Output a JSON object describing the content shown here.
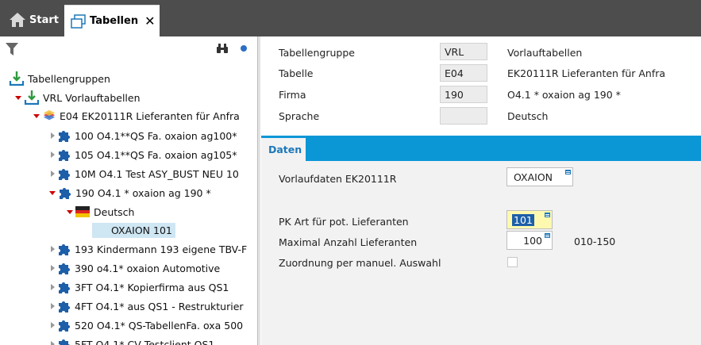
{
  "tabs": {
    "start_label": "Start",
    "tabellen_label": "Tabellen"
  },
  "tree": {
    "nodes": [
      {
        "label": "Tabellengruppen"
      },
      {
        "label": "VRL  Vorlauftabellen"
      },
      {
        "label": "E04  EK20111R Lieferanten für Anfra"
      },
      {
        "label": "100 O4.1**QS Fa. oxaion ag100*"
      },
      {
        "label": "105 O4.1**QS Fa. oxaion ag105*"
      },
      {
        "label": "10M O4.1 Test ASY_BUST NEU   10"
      },
      {
        "label": "190 O4.1 * oxaion ag 190   *"
      },
      {
        "label": "Deutsch"
      },
      {
        "label": "OXAION  101"
      },
      {
        "label": "193 Kindermann 193 eigene TBV-F"
      },
      {
        "label": "390 o4.1* oxaion Automotive"
      },
      {
        "label": "3FT O4.1* Kopierfirma aus  QS1"
      },
      {
        "label": "4FT O4.1* aus QS1 - Restrukturier"
      },
      {
        "label": "520 O4.1* QS-TabellenFa. oxa 500"
      },
      {
        "label": "5FT O4.1* CV Testclient QS1"
      }
    ]
  },
  "header": {
    "tabellengruppe": {
      "label": "Tabellengruppe",
      "value": "VRL",
      "desc": "Vorlauftabellen"
    },
    "tabelle": {
      "label": "Tabelle",
      "value": "E04",
      "desc": "EK20111R Lieferanten für Anfra"
    },
    "firma": {
      "label": "Firma",
      "value": "190",
      "desc": "O4.1 * oxaion ag 190   *"
    },
    "sprache": {
      "label": "Sprache",
      "value": "",
      "desc": "Deutsch"
    }
  },
  "daten": {
    "tab_label": "Daten",
    "vorlaufdaten": {
      "label": "Vorlaufdaten EK20111R",
      "value": "OXAION"
    },
    "pk_art": {
      "label": "PK Art für pot. Lieferanten",
      "value": "101"
    },
    "max_anzahl": {
      "label": "Maximal Anzahl Lieferanten",
      "value": "100",
      "range": "010-150"
    },
    "zuordnung": {
      "label": "Zuordnung per manuel. Auswahl",
      "checked": false
    }
  },
  "colors": {
    "topbar": "#4d4d4d",
    "accent": "#0b96d6",
    "tab_text": "#1d78b9",
    "selection": "#cfe6f3",
    "highlight_input": "#fff9b0"
  }
}
